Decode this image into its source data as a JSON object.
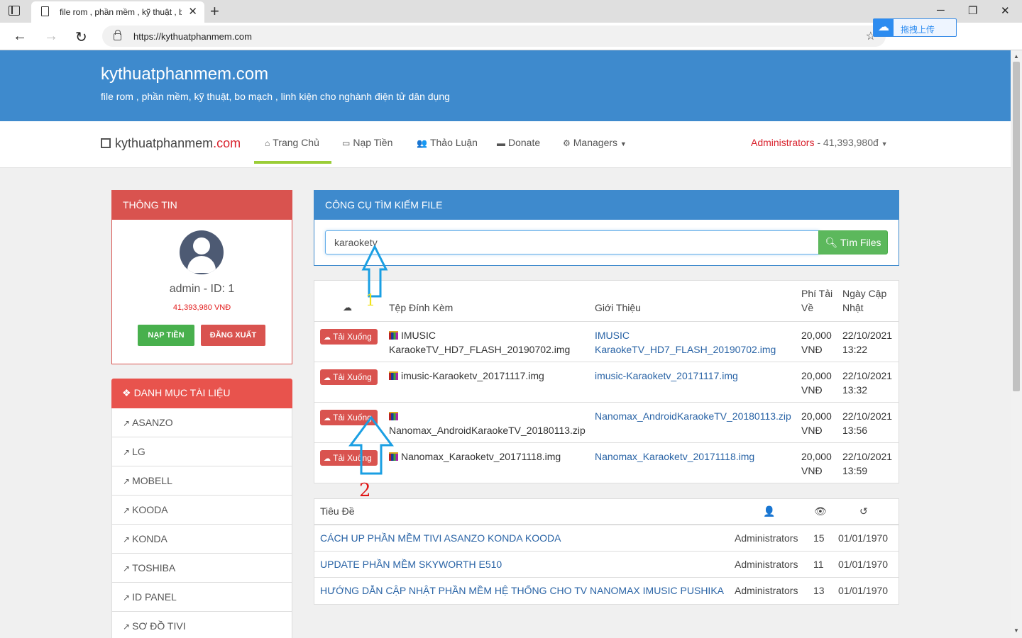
{
  "browser": {
    "tab_title": "file rom , phần mềm , kỹ thuật , b",
    "url": "https://kythuatphanmem.com",
    "extension_label": "拖拽上传"
  },
  "hero": {
    "title": "kythuatphanmem.com",
    "subtitle": "file rom , phần mềm, kỹ thuật, bo mạch , linh kiện cho nghành điện tử dân dụng"
  },
  "navbar": {
    "brand_main": "kythuatphanmem",
    "brand_suffix": ".com",
    "items": [
      {
        "label": "Trang Chủ",
        "icon": "home-icon"
      },
      {
        "label": "Nạp Tiền",
        "icon": "money-icon"
      },
      {
        "label": "Thảo Luận",
        "icon": "users-icon"
      },
      {
        "label": "Donate",
        "icon": "credit-card-icon"
      },
      {
        "label": "Managers",
        "icon": "cogs-icon"
      }
    ],
    "user_name": "Administrators",
    "user_balance": " - 41,393,980đ"
  },
  "info_panel": {
    "title": "THÔNG TIN",
    "user": "admin - ID: 1",
    "balance": "41,393,980 VNĐ",
    "btn_topup": "NẠP TIỀN",
    "btn_logout": "ĐĂNG XUẤT"
  },
  "category_panel": {
    "title": "DANH MỤC TÀI LIỆU",
    "items": [
      "ASANZO",
      "LG",
      "MOBELL",
      "KOODA",
      "KONDA",
      "TOSHIBA",
      "ID PANEL",
      "SƠ ĐỒ TIVI"
    ]
  },
  "search": {
    "title": "CÔNG CỤ TÌM KIẾM FILE",
    "value": "karaoketv",
    "button": "Tìm Files"
  },
  "results": {
    "headers": {
      "file": "Tệp Đính Kèm",
      "desc": "Giới Thiệu",
      "fee": "Phí Tải Về",
      "date": "Ngày Cập Nhật"
    },
    "download_label": "Tải Xuống",
    "rows": [
      {
        "file": "IMUSIC KaraokeTV_HD7_FLASH_20190702.img",
        "desc": "IMUSIC KaraokeTV_HD7_FLASH_20190702.img",
        "fee": "20,000 VNĐ",
        "date": "22/10/2021 13:22"
      },
      {
        "file": "imusic-Karaoketv_20171117.img",
        "desc": "imusic-Karaoketv_20171117.img",
        "fee": "20,000 VNĐ",
        "date": "22/10/2021 13:32"
      },
      {
        "file": "Nanomax_AndroidKaraokeTV_20180113.zip",
        "desc": "Nanomax_AndroidKaraokeTV_20180113.zip",
        "fee": "20,000 VNĐ",
        "date": "22/10/2021 13:56"
      },
      {
        "file": "Nanomax_Karaoketv_20171118.img",
        "desc": "Nanomax_Karaoketv_20171118.img",
        "fee": "20,000 VNĐ",
        "date": "22/10/2021 13:59"
      }
    ]
  },
  "topics": {
    "header_title": "Tiêu Đề",
    "rows": [
      {
        "title": "CÁCH UP PHẦN MỀM TIVI ASANZO KONDA KOODA",
        "author": "Administrators",
        "views": "15",
        "date": "01/01/1970"
      },
      {
        "title": "UPDATE PHẦN MỀM SKYWORTH E510",
        "author": "Administrators",
        "views": "11",
        "date": "01/01/1970"
      },
      {
        "title": "HƯỚNG DẪN CẬP NHẬT PHẦN MỀM HỆ THỐNG CHO TV NANOMAX IMUSIC PUSHIKA",
        "author": "Administrators",
        "views": "13",
        "date": "01/01/1970"
      }
    ]
  },
  "annotations": {
    "label_1": "1",
    "label_2": "2",
    "color_1": "#f0e21a",
    "color_2": "#e01515",
    "arrow_color": "#1a9fe3"
  }
}
